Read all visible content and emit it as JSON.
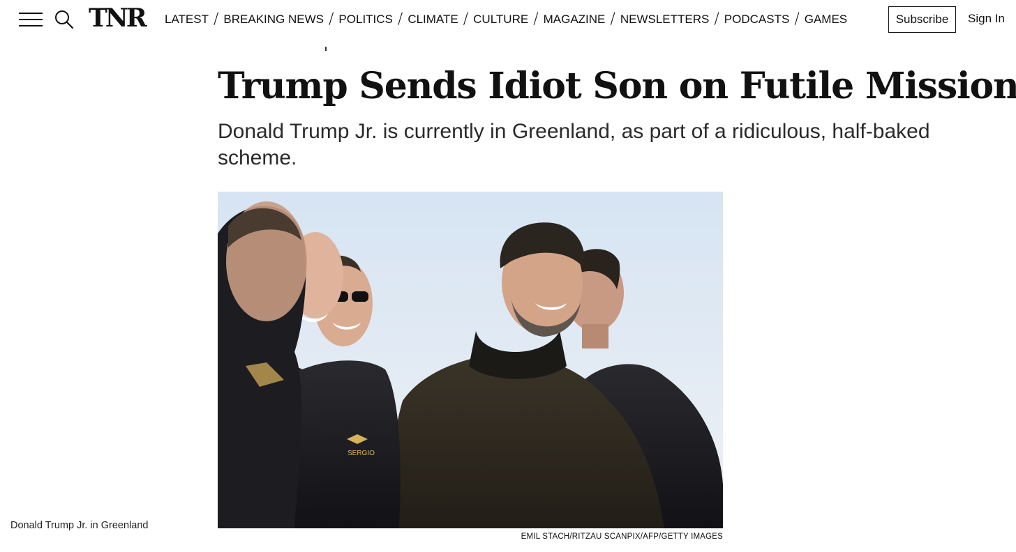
{
  "header": {
    "logo": "TNR",
    "nav": [
      "LATEST",
      "BREAKING NEWS",
      "POLITICS",
      "CLIMATE",
      "CULTURE",
      "MAGAZINE",
      "NEWSLETTERS",
      "PODCASTS",
      "GAMES"
    ],
    "subscribe_label": "Subscribe",
    "signin_label": "Sign In",
    "icons": [
      "menu-icon",
      "search-icon"
    ]
  },
  "article": {
    "headline": "Trump Sends Idiot Son on Futile Mission",
    "dek": "Donald Trump Jr. is currently in Greenland, as part of a ridiculous, half-baked scheme.",
    "image": {
      "caption": "Donald Trump Jr. in Greenland",
      "credit": "EMIL STACH/RITZAU SCANPIX/AFP/GETTY IMAGES",
      "jacket_names": [
        "SERGIO"
      ]
    }
  }
}
